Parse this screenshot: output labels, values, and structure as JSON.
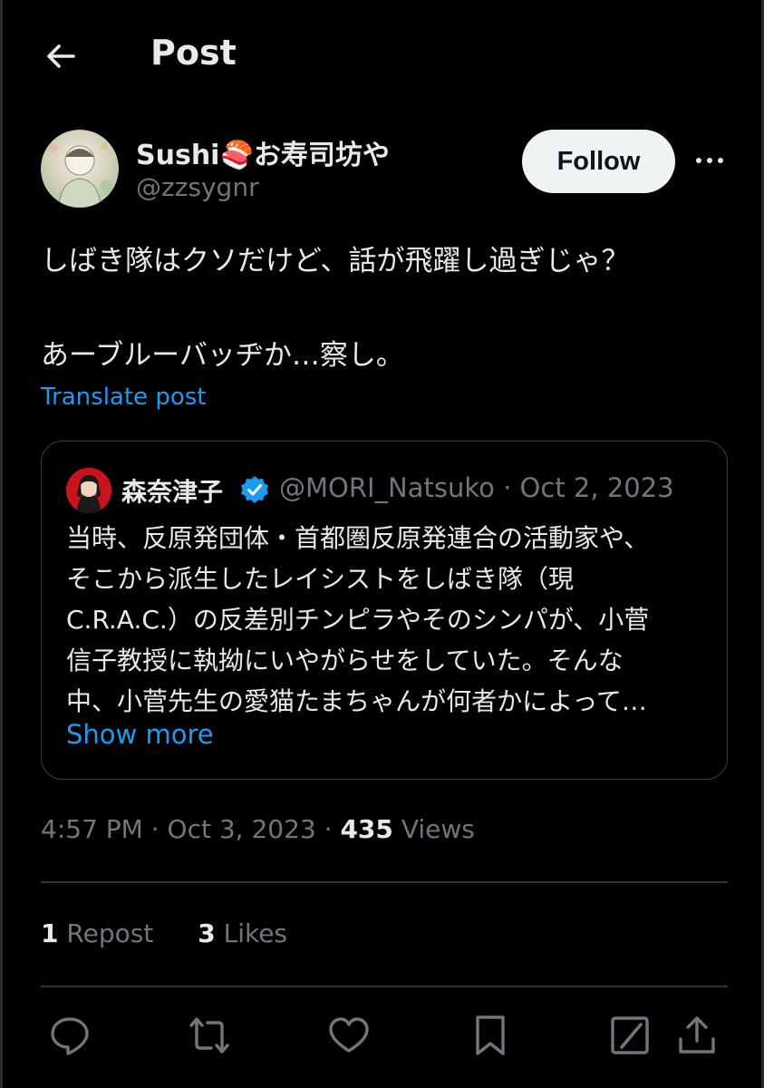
{
  "header": {
    "title": "Post",
    "back_icon": "arrow-left-icon"
  },
  "author": {
    "display_name": "Sushi🍣お寿司坊や",
    "handle": "@zzsygnr",
    "follow_label": "Follow",
    "more_icon": "more-horizontal-icon"
  },
  "post": {
    "lines": [
      "しばき隊はクソだけど、話が飛躍し過ぎじゃ？",
      "",
      "あーブルーバッヂか…察し。"
    ],
    "translate_label": "Translate post"
  },
  "quote": {
    "display_name": "森奈津子",
    "verified_icon": "verified-badge-icon",
    "handle": "@MORI_Natsuko",
    "separator": "·",
    "date": "Oct 2, 2023",
    "lines": [
      "当時、反原発団体・首都圏反原発連合の活動家や、",
      "そこから派生したレイシストをしばき隊（現",
      "C.R.A.C.）の反差別チンピラやそのシンパが、小菅",
      "信子教授に執拗にいやがらせをしていた。そんな",
      "中、小菅先生の愛猫たまちゃんが何者かによって…"
    ],
    "show_more_label": "Show more"
  },
  "meta": {
    "time": "4:57 PM",
    "date": "Oct 3, 2023",
    "separator": "·",
    "views_count": "435",
    "views_label": "Views"
  },
  "stats": {
    "reposts_count": "1",
    "reposts_label": "Repost",
    "likes_count": "3",
    "likes_label": "Likes"
  },
  "actions": [
    "reply-icon",
    "repost-icon",
    "like-icon",
    "bookmark-icon",
    "grok-icon",
    "share-icon"
  ],
  "colors": {
    "background": "#000000",
    "text": "#e7e9ea",
    "muted": "#71767b",
    "accent": "#1d9bf0",
    "divider": "#2f3336"
  }
}
